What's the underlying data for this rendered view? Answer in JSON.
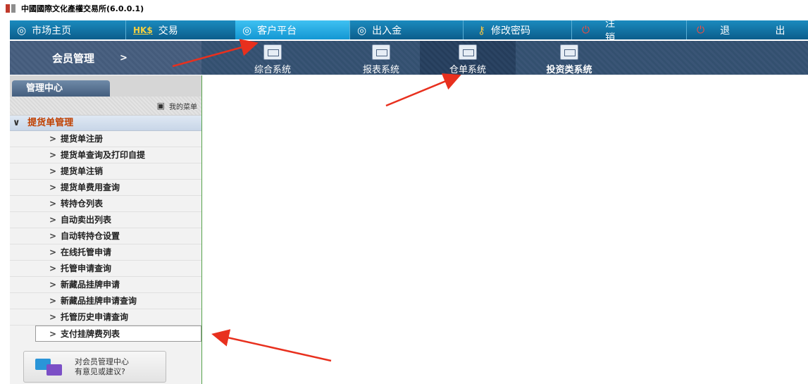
{
  "window": {
    "title": "中國國際文化產權交易所(6.0.0.1)"
  },
  "topnav": {
    "items": [
      {
        "label": "市场主页",
        "icon": "circle-refresh-icon"
      },
      {
        "label": "交易",
        "icon": "hk-dollar-icon",
        "icon_text": "HK$"
      },
      {
        "label": "客户平台",
        "icon": "circle-refresh-icon",
        "active": true
      },
      {
        "label": "出入金",
        "icon": "circle-refresh-icon"
      },
      {
        "label": "修改密码",
        "icon": "key-icon"
      },
      {
        "label": "注 销",
        "icon": "power-icon"
      },
      {
        "label": "退 出",
        "icon": "power-icon"
      }
    ]
  },
  "toolbar": {
    "section_title": "会员管理",
    "section_arrow": ">",
    "systems": [
      {
        "label": "综合系统",
        "icon": "window-icon"
      },
      {
        "label": "报表系统",
        "icon": "folder-report-icon"
      },
      {
        "label": "仓单系统",
        "icon": "printer-icon",
        "active": true
      },
      {
        "label": "投资类系统",
        "icon": "money-document-icon"
      }
    ]
  },
  "sidebar": {
    "tab_label": "管理中心",
    "my_menu_label": "我的菜单",
    "group_title": "提货单管理",
    "items": [
      "提货单注册",
      "提货单查询及打印自提",
      "提货单注销",
      "提货单费用查询",
      "转持仓列表",
      "自动卖出列表",
      "自动转持仓设置",
      "在线托管申请",
      "托管申请查询",
      "新藏品挂牌申请",
      "新藏品挂牌申请查询",
      "托管历史申请查询",
      "支付挂牌费列表"
    ],
    "selected_index": 12,
    "feedback": {
      "line1": "对会员管理中心",
      "line2": "有意见或建议?"
    }
  },
  "colors": {
    "nav_bg": "#0b5d8b",
    "nav_active": "#1397d3",
    "group_title": "#c04000",
    "annotation_arrow": "#e8301e",
    "splitter": "#55a24a"
  }
}
